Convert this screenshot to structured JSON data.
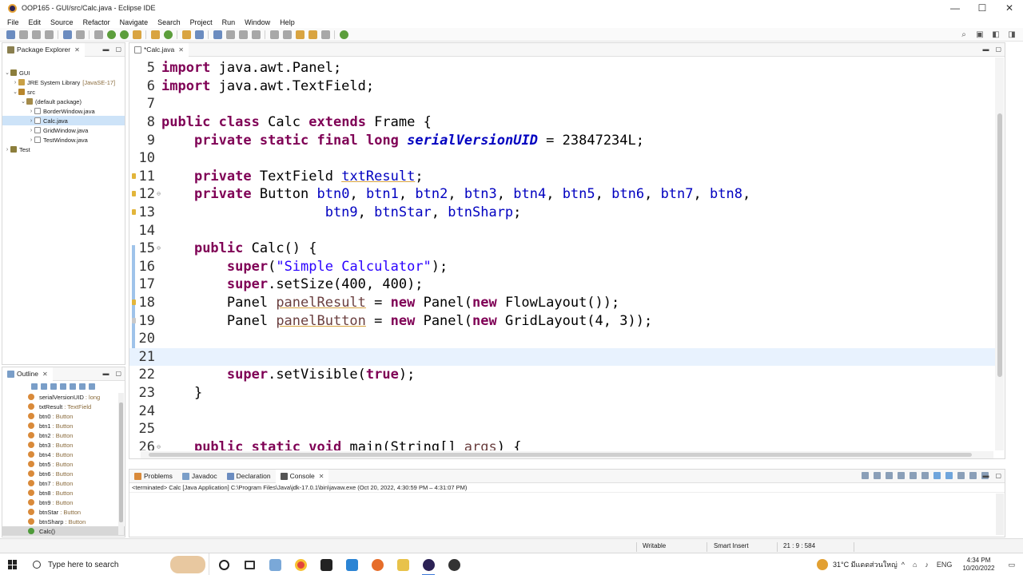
{
  "window": {
    "title": "OOP165 - GUI/src/Calc.java - Eclipse IDE",
    "controls": [
      "—",
      "☐",
      "✕"
    ]
  },
  "menu": [
    "File",
    "Edit",
    "Source",
    "Refactor",
    "Navigate",
    "Search",
    "Project",
    "Run",
    "Window",
    "Help"
  ],
  "package_explorer": {
    "tab_label": "Package Explorer",
    "tree": [
      {
        "label": "GUI",
        "sub": "",
        "icon": "project-icon"
      },
      {
        "label": "JRE System Library",
        "sub": "[JavaSE-17]",
        "icon": "library-icon"
      },
      {
        "label": "src",
        "sub": "",
        "icon": "source-folder-icon"
      },
      {
        "label": "(default package)",
        "sub": "",
        "icon": "package-icon"
      },
      {
        "label": "BorderWindow.java",
        "sub": "",
        "icon": "java-file-icon"
      },
      {
        "label": "Calc.java",
        "sub": "",
        "icon": "java-file-icon"
      },
      {
        "label": "GridWindow.java",
        "sub": "",
        "icon": "java-file-icon"
      },
      {
        "label": "TestWindow.java",
        "sub": "",
        "icon": "java-file-icon"
      },
      {
        "label": "Test",
        "sub": "",
        "icon": "project-icon"
      }
    ]
  },
  "outline": {
    "tab_label": "Outline",
    "items": [
      {
        "name": "serialVersionUID",
        "type": " : long"
      },
      {
        "name": "txtResult",
        "type": " : TextField"
      },
      {
        "name": "btn0",
        "type": " : Button"
      },
      {
        "name": "btn1",
        "type": " : Button"
      },
      {
        "name": "btn2",
        "type": " : Button"
      },
      {
        "name": "btn3",
        "type": " : Button"
      },
      {
        "name": "btn4",
        "type": " : Button"
      },
      {
        "name": "btn5",
        "type": " : Button"
      },
      {
        "name": "btn6",
        "type": " : Button"
      },
      {
        "name": "btn7",
        "type": " : Button"
      },
      {
        "name": "btn8",
        "type": " : Button"
      },
      {
        "name": "btn9",
        "type": " : Button"
      },
      {
        "name": "btnStar",
        "type": " : Button"
      },
      {
        "name": "btnSharp",
        "type": " : Button"
      },
      {
        "name": "Calc()",
        "type": ""
      }
    ]
  },
  "editor": {
    "tab_label": "*Calc.java",
    "line_numbers": [
      "5",
      "6",
      "7",
      "8",
      "9",
      "10",
      "11",
      "12",
      "13",
      "14",
      "15",
      "16",
      "17",
      "18",
      "19",
      "20",
      "21",
      "22",
      "23",
      "24",
      "25",
      "26"
    ],
    "code": {
      "l5_kw": "import",
      "l5_rest": " java.awt.Panel;",
      "l6_kw": "import",
      "l6_rest": " java.awt.TextField;",
      "l8_kw1": "public",
      "l8_kw2": "class",
      "l8_mid": " Calc ",
      "l8_kw3": "extends",
      "l8_rest": " Frame {",
      "l9_kw1": "private",
      "l9_kw2": "static",
      "l9_kw3": "final",
      "l9_kw4": "long",
      "l9_field": "serialVersionUID",
      "l9_rest": " = 23847234L;",
      "l11_kw": "private",
      "l11_type": " TextField ",
      "l11_field": "txtResult",
      "l11_rest": ";",
      "l12_kw": "private",
      "l12_type": " Button ",
      "l12_fields": "btn0",
      "l12_rest": ", btn1, btn2, btn3, btn4, btn5, btn6, btn7, btn8,",
      "l12_list": [
        "btn1",
        "btn2",
        "btn3",
        "btn4",
        "btn5",
        "btn6",
        "btn7",
        "btn8"
      ],
      "l13_list": [
        "btn9",
        "btnStar",
        "btnSharp"
      ],
      "l15_kw": "public",
      "l15_rest": " Calc() {",
      "l16_kw": "super",
      "l16_pre": "(",
      "l16_str": "\"Simple Calculator\"",
      "l16_post": ");",
      "l17_kw": "super",
      "l17_rest": ".setSize(400, 400);",
      "l18_type": "Panel ",
      "l18_var": "panelResult",
      "l18_eq": " = ",
      "l18_new1": "new",
      "l18_mid": " Panel(",
      "l18_new2": "new",
      "l18_rest": " FlowLayout());",
      "l19_type": "Panel ",
      "l19_var": "panelButton",
      "l19_eq": " = ",
      "l19_new1": "new",
      "l19_mid": " Panel(",
      "l19_new2": "new",
      "l19_rest": " GridLayout(4, 3));",
      "l22_kw": "super",
      "l22_mid": ".setVisible(",
      "l22_kw2": "true",
      "l22_rest": ");",
      "l23": "}",
      "l26_kw1": "public",
      "l26_kw2": "static",
      "l26_kw3": "void",
      "l26_mid": " main(String[] ",
      "l26_param": "args",
      "l26_rest": ") {"
    }
  },
  "bottom_tabs": [
    "Problems",
    "Javadoc",
    "Declaration",
    "Console"
  ],
  "console": {
    "info": "<terminated> Calc [Java Application] C:\\Program Files\\Java\\jdk-17.0.1\\bin\\javaw.exe  (Oct 20, 2022, 4:30:59 PM – 4:31:07 PM)"
  },
  "status": {
    "writable": "Writable",
    "insert_mode": "Smart Insert",
    "position": "21 : 9 : 584"
  },
  "taskbar": {
    "search_placeholder": "Type here to search",
    "weather": "31°C  มีแดดส่วนใหญ่",
    "language": "ENG",
    "time": "4:34 PM",
    "date": "10/20/2022"
  }
}
